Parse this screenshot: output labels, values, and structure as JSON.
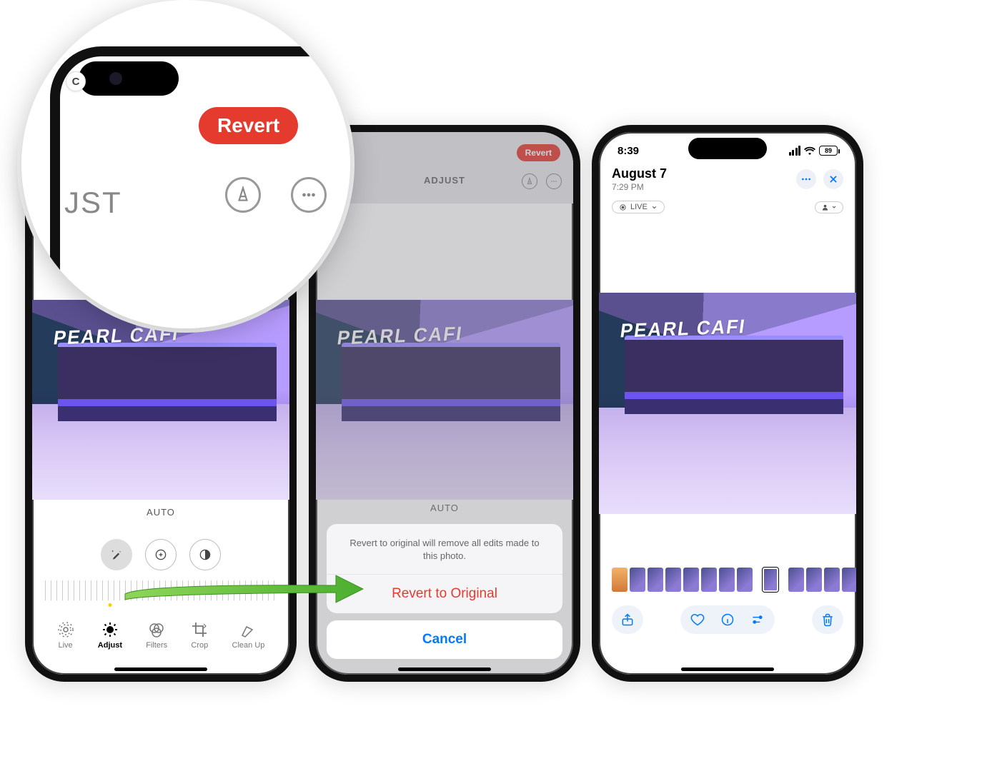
{
  "zoom": {
    "revert_label": "Revert",
    "mode_label_partial": "JST",
    "cancel_hint": "C"
  },
  "screen1": {
    "auto_label": "AUTO",
    "tabs": [
      "Live",
      "Adjust",
      "Filters",
      "Crop",
      "Clean Up"
    ],
    "active_tab": 1
  },
  "screen2": {
    "mode_label": "ADJUST",
    "revert_label": "Revert",
    "auto_label": "AUTO",
    "sheet": {
      "message": "Revert to original will remove all edits made to this photo.",
      "revert_action": "Revert to Original",
      "cancel_action": "Cancel"
    }
  },
  "screen3": {
    "status": {
      "time": "8:39",
      "battery": "89"
    },
    "header": {
      "date": "August 7",
      "time": "7:29 PM",
      "live_label": "LIVE"
    }
  }
}
